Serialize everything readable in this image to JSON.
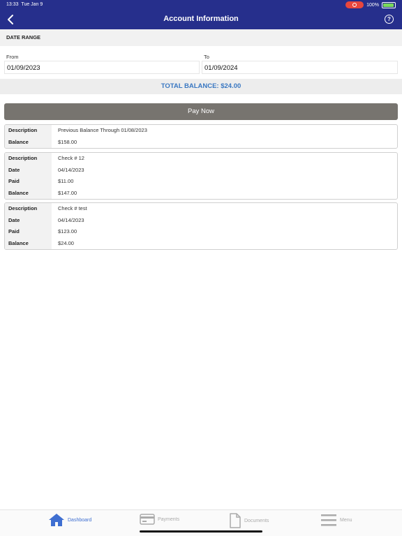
{
  "status_bar": {
    "time": "13:33",
    "date": "Tue Jan 9",
    "battery": "100%"
  },
  "header": {
    "title": "Account Information",
    "help_label": "?"
  },
  "date_range": {
    "heading": "DATE RANGE",
    "from_label": "From",
    "from_value": "01/09/2023",
    "to_label": "To",
    "to_value": "01/09/2024"
  },
  "total_balance": "TOTAL BALANCE: $24.00",
  "pay_now_label": "Pay Now",
  "transactions": [
    {
      "rows": [
        {
          "k": "Description",
          "v": "Previous Balance Through 01/08/2023"
        },
        {
          "k": "Balance",
          "v": "$158.00"
        }
      ]
    },
    {
      "rows": [
        {
          "k": "Description",
          "v": "Check # 12"
        },
        {
          "k": "Date",
          "v": "04/14/2023"
        },
        {
          "k": "Paid",
          "v": "$11.00"
        },
        {
          "k": "Balance",
          "v": "$147.00"
        }
      ]
    },
    {
      "rows": [
        {
          "k": "Description",
          "v": "Check # test"
        },
        {
          "k": "Date",
          "v": "04/14/2023"
        },
        {
          "k": "Paid",
          "v": "$123.00"
        },
        {
          "k": "Balance",
          "v": "$24.00"
        }
      ]
    }
  ],
  "nav": {
    "dashboard": "Dashboard",
    "payments": "Payments",
    "documents": "Documents",
    "menu": "Menu"
  },
  "colors": {
    "header_bg": "#262f8c",
    "accent": "#3a78c2",
    "pay_button": "#77746f",
    "active_nav": "#3f6fd1"
  }
}
